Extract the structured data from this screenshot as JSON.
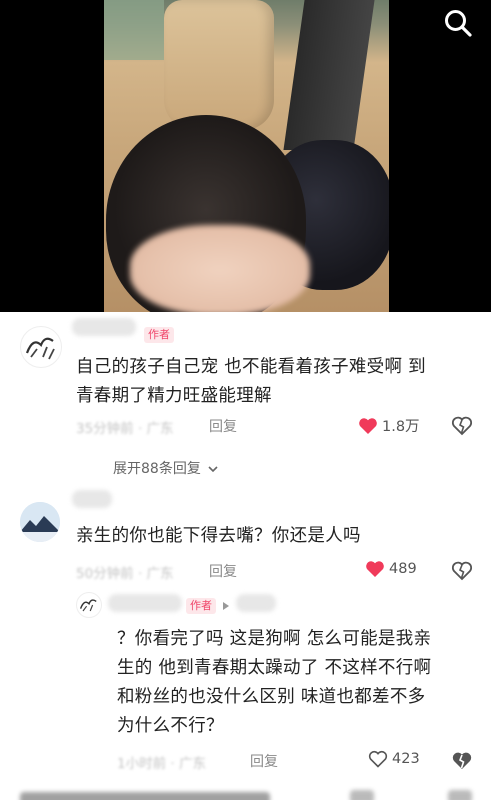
{
  "video": {
    "search_icon": "search-icon"
  },
  "comments": [
    {
      "badge": "作者",
      "text_line1": "自己的孩子自己宠 也不能看着孩子难受啊 到",
      "text_line2": "青春期了精力旺盛能理解",
      "time": "35分钟前 · 广东",
      "reply_label": "回复",
      "likes": "1.8万",
      "liked": true,
      "expand_label": "展开88条回复"
    },
    {
      "text": "亲生的你也能下得去嘴？你还是人吗",
      "time": "50分钟前 · 广东",
      "reply_label": "回复",
      "likes": "489",
      "liked": true
    },
    {
      "badge": "作者",
      "text_line1": "？你看完了吗 这是狗啊 怎么可能是我亲",
      "text_line2": "生的 他到青春期太躁动了 不这样不行啊",
      "text_line3": "和粉丝的也没什么区别 味道也都差不多",
      "text_line4": "为什么不行？",
      "time": "1小时前 · 广东",
      "reply_label": "回复",
      "likes": "423",
      "liked": false
    }
  ],
  "colors": {
    "like_red": "#f03a5a",
    "badge_bg": "#fde7ea",
    "badge_text": "#f0456a",
    "meta_gray": "#c4c4c4"
  }
}
